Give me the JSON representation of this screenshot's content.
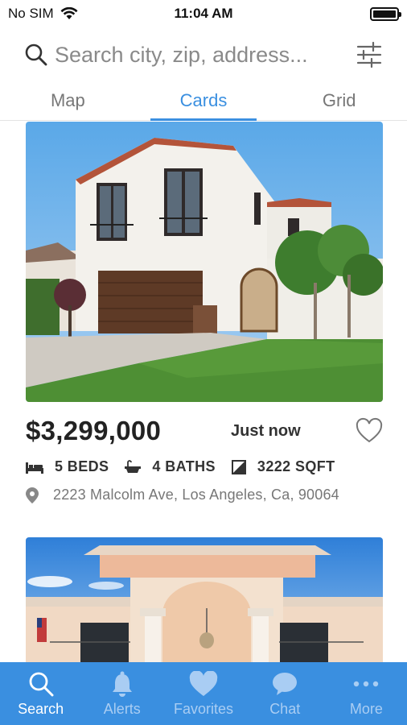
{
  "status_bar": {
    "carrier": "No SIM",
    "time": "11:04 AM",
    "battery_level": 1.0
  },
  "search": {
    "placeholder": "Search city, zip, address...",
    "icon": "search-icon",
    "filter_icon": "sliders-icon"
  },
  "view_tabs": [
    {
      "label": "Map",
      "active": false
    },
    {
      "label": "Cards",
      "active": true
    },
    {
      "label": "Grid",
      "active": false
    }
  ],
  "listings": [
    {
      "price": "$3,299,000",
      "posted": "Just now",
      "beds": "5 BEDS",
      "baths": "4 BATHS",
      "sqft": "3222 SQFT",
      "address": "2223 Malcolm Ave, Los Angeles, Ca, 90064",
      "favorited": false
    },
    {
      "price": "",
      "posted": "",
      "beds": "",
      "baths": "",
      "sqft": "",
      "address": "",
      "favorited": false
    }
  ],
  "bottom_nav": [
    {
      "label": "Search",
      "icon": "search-icon",
      "active": true
    },
    {
      "label": "Alerts",
      "icon": "bell-icon",
      "active": false
    },
    {
      "label": "Favorites",
      "icon": "heart-icon",
      "active": false
    },
    {
      "label": "Chat",
      "icon": "chat-bubble-icon",
      "active": false
    },
    {
      "label": "More",
      "icon": "more-dots-icon",
      "active": false
    }
  ],
  "colors": {
    "accent": "#3a8fe0",
    "nav_inactive": "#a9cdf3",
    "price_text": "#222222",
    "muted_text": "#777777"
  }
}
